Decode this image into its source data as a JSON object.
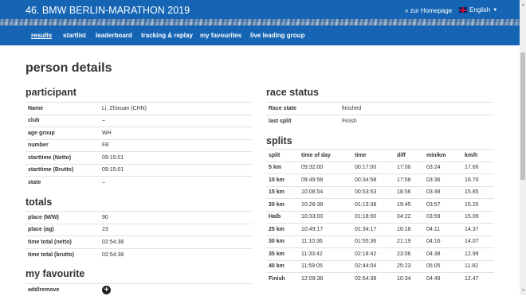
{
  "header": {
    "app_title": "46. BMW BERLIN-MARATHON 2019",
    "homepage_link": "« zur Homepage",
    "language": "English"
  },
  "nav": {
    "items": [
      "results",
      "startlist",
      "leaderboard",
      "tracking & replay",
      "my favourites",
      "live leading group"
    ],
    "active": "results"
  },
  "page_title": "person details",
  "participant": {
    "title": "participant",
    "rows": [
      {
        "label": "Name",
        "value": "Li, Zhixuan (CHN)"
      },
      {
        "label": "club",
        "value": "–"
      },
      {
        "label": "age group",
        "value": "WH"
      },
      {
        "label": "number",
        "value": "F8"
      },
      {
        "label": "starttime (Netto)",
        "value": "09:15:01"
      },
      {
        "label": "starttime (Brutto)",
        "value": "09:15:01"
      },
      {
        "label": "state",
        "value": "–"
      }
    ]
  },
  "totals": {
    "title": "totals",
    "rows": [
      {
        "label": "place (M/W)",
        "value": "90"
      },
      {
        "label": "place (ag)",
        "value": "23"
      },
      {
        "label": "time total (netto)",
        "value": "02:54:38"
      },
      {
        "label": "time total (brutto)",
        "value": "02:54:38"
      }
    ]
  },
  "favourite": {
    "title": "my favourite",
    "label": "add/remove",
    "icon": "plus-circle-icon"
  },
  "race_status": {
    "title": "race status",
    "rows": [
      {
        "label": "Race state",
        "value": "finished"
      },
      {
        "label": "last split",
        "value": "Finish"
      }
    ]
  },
  "splits": {
    "title": "splits",
    "columns": [
      "split",
      "time of day",
      "time",
      "diff",
      "min/km",
      "km/h"
    ],
    "rows": [
      [
        "5 km",
        "09:32:00",
        "00:17:00",
        "17:00",
        "03:24",
        "17.66"
      ],
      [
        "10 km",
        "09:49:58",
        "00:34:58",
        "17:58",
        "03:36",
        "16.70"
      ],
      [
        "15 km",
        "10:08:54",
        "00:53:53",
        "18:56",
        "03:48",
        "15.85"
      ],
      [
        "20 km",
        "10:28:38",
        "01:13:38",
        "19:45",
        "03:57",
        "15.20"
      ],
      [
        "Halb",
        "10:33:00",
        "01:18:00",
        "04:22",
        "03:59",
        "15.09"
      ],
      [
        "25 km",
        "10:49:17",
        "01:34:17",
        "16:18",
        "04:11",
        "14.37"
      ],
      [
        "30 km",
        "11:10:36",
        "01:55:36",
        "21:19",
        "04:16",
        "14.07"
      ],
      [
        "35 km",
        "11:33:42",
        "02:18:42",
        "23:06",
        "04:38",
        "12.99"
      ],
      [
        "40 km",
        "11:59:05",
        "02:44:04",
        "25:23",
        "05:05",
        "11.82"
      ],
      [
        "Finish",
        "12:09:38",
        "02:54:38",
        "10:34",
        "04:49",
        "12.47"
      ]
    ]
  }
}
